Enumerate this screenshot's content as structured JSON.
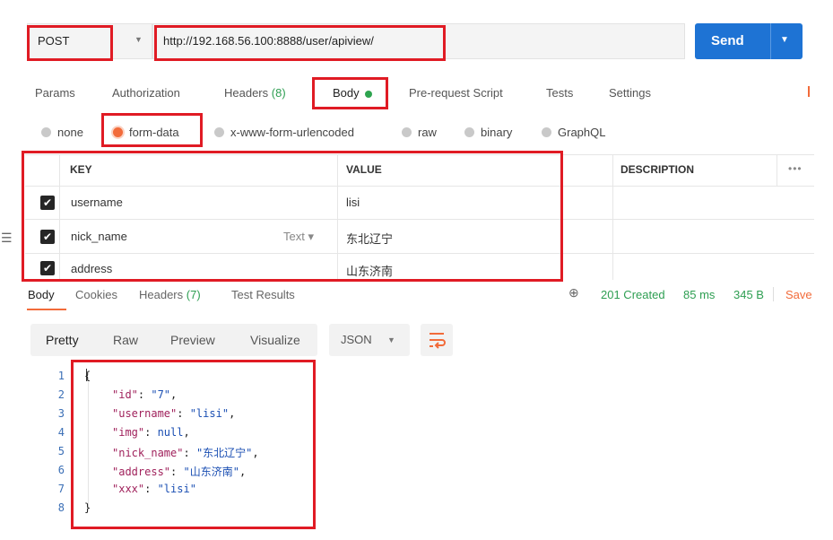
{
  "request": {
    "method": "POST",
    "url": "http://192.168.56.100:8888/user/apiview/",
    "send_label": "Send"
  },
  "request_tabs": [
    {
      "label": "Params"
    },
    {
      "label": "Authorization"
    },
    {
      "label": "Headers",
      "count": "(8)"
    },
    {
      "label": "Body"
    },
    {
      "label": "Pre-request Script"
    },
    {
      "label": "Tests"
    },
    {
      "label": "Settings"
    }
  ],
  "body_types": [
    {
      "label": "none",
      "selected": false
    },
    {
      "label": "form-data",
      "selected": true
    },
    {
      "label": "x-www-form-urlencoded",
      "selected": false
    },
    {
      "label": "raw",
      "selected": false
    },
    {
      "label": "binary",
      "selected": false
    },
    {
      "label": "GraphQL",
      "selected": false
    }
  ],
  "params_table": {
    "headers": {
      "key": "KEY",
      "value": "VALUE",
      "description": "DESCRIPTION",
      "more": "•••"
    },
    "rows": [
      {
        "key": "username",
        "value": "lisi",
        "checked": true
      },
      {
        "key": "nick_name",
        "value": "东北辽宁",
        "checked": true,
        "type": "Text ▾"
      },
      {
        "key": "address",
        "value": "山东济南",
        "checked": true
      }
    ]
  },
  "response_tabs": [
    {
      "label": "Body"
    },
    {
      "label": "Cookies"
    },
    {
      "label": "Headers",
      "count": "(7)"
    },
    {
      "label": "Test Results"
    }
  ],
  "response_status": {
    "status": "201 Created",
    "time": "85 ms",
    "size": "345 B",
    "save": "Save"
  },
  "view_modes": [
    "Pretty",
    "Raw",
    "Preview",
    "Visualize"
  ],
  "format": "JSON",
  "code": {
    "line_numbers": [
      "1",
      "2",
      "3",
      "4",
      "5",
      "6",
      "7",
      "8"
    ],
    "open": "{",
    "close": "}",
    "fields": [
      {
        "key": "\"id\"",
        "value": "\"7\"",
        "comma": ","
      },
      {
        "key": "\"username\"",
        "value": "\"lisi\"",
        "comma": ","
      },
      {
        "key": "\"img\"",
        "value": "null",
        "comma": ","
      },
      {
        "key": "\"nick_name\"",
        "value": "\"东北辽宁\"",
        "comma": ","
      },
      {
        "key": "\"address\"",
        "value": "\"山东济南\"",
        "comma": ","
      },
      {
        "key": "\"xxx\"",
        "value": "\"lisi\"",
        "comma": ""
      }
    ]
  },
  "colors": {
    "accent": "#f26b3a",
    "send_button": "#1e73d4",
    "highlight_box": "#e01b24",
    "status_ok": "#2e9e52"
  }
}
